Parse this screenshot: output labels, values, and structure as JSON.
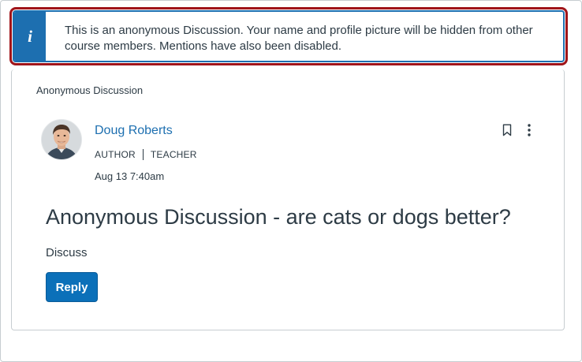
{
  "alert": {
    "icon": "info-icon",
    "icon_glyph": "i",
    "message": "This is an anonymous Discussion. Your name and profile picture will be hidden from other course members. Mentions have also been disabled.",
    "accent_color": "#1d6fb0",
    "highlight_color": "#a0151a"
  },
  "discussion": {
    "type_label": "Anonymous Discussion",
    "author": {
      "name": "Doug Roberts",
      "roles": [
        "AUTHOR",
        "TEACHER"
      ],
      "avatar_icon": "user-avatar"
    },
    "timestamp": "Aug 13 7:40am",
    "title": "Anonymous Discussion - are cats or dogs better?",
    "body": "Discuss",
    "actions": {
      "bookmark_icon": "bookmark-icon",
      "more_icon": "more-options-icon",
      "reply_label": "Reply"
    },
    "link_color": "#1d6fb0",
    "button_color": "#0b70b9"
  }
}
